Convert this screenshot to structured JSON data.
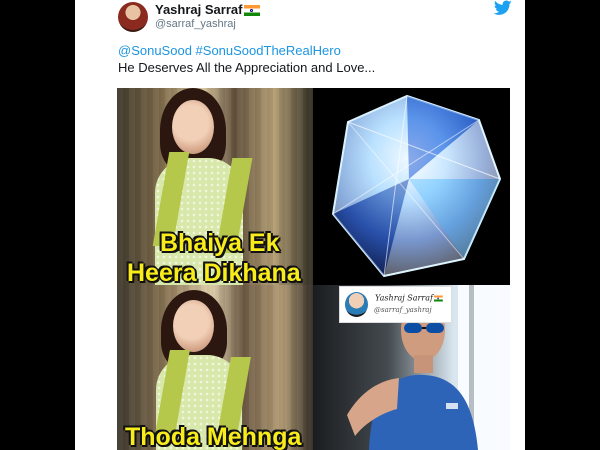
{
  "tweet": {
    "author_name": "Yashraj Sarraf",
    "author_handle": "@sarraf_yashraj",
    "mentions": [
      "@SonuSood",
      "#SonuSoodTheRealHero"
    ],
    "body": "He Deserves All the Appreciation and Love..."
  },
  "meme": {
    "caption_line1": "Bhaiya Ek",
    "caption_line2": "Heera Dikhana",
    "caption_line3": "Thoda Mehnga",
    "watermark_name": "Yashraj Sarraf",
    "watermark_handle": "@sarraf_yashraj"
  },
  "colors": {
    "link_blue": "#1b95e0",
    "twitter_blue": "#1da1f2",
    "caption_yellow": "#f8ec1a"
  },
  "icons": {
    "brand": "twitter-bird-icon",
    "country": "india-flag-icon"
  }
}
